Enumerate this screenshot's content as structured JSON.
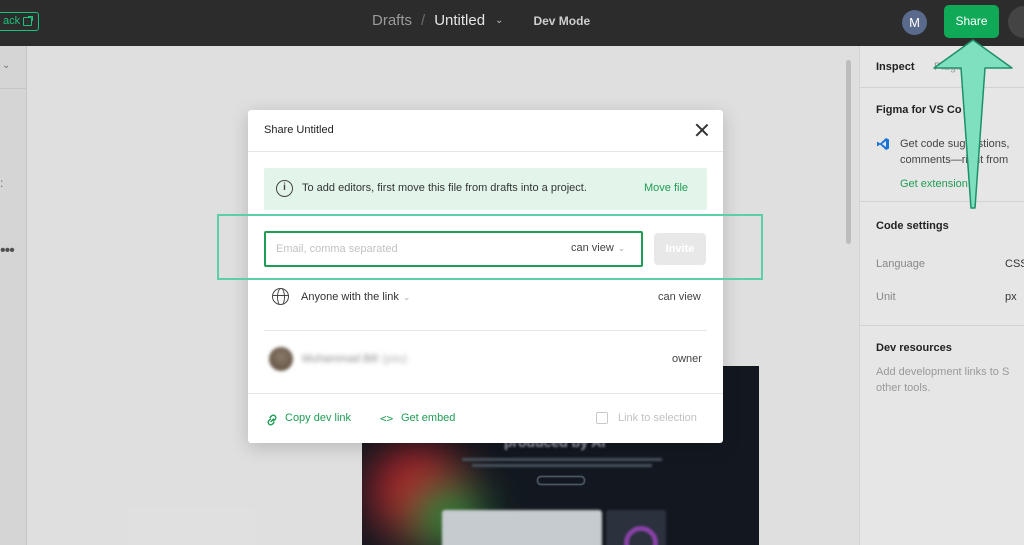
{
  "topbar": {
    "back_label": "ack",
    "breadcrumb_root": "Drafts",
    "breadcrumb_sep": "/",
    "file_name": "Untitled",
    "dev_mode_label": "Dev Mode",
    "avatar_initial": "M",
    "share_label": "Share"
  },
  "right_panel": {
    "tab_inspect": "Inspect",
    "tab_plugins": "Plugins",
    "vscode_title": "Figma for VS Co",
    "vscode_line1": "Get code suggestions,",
    "vscode_line2": "comments—right from",
    "vscode_link": "Get extension",
    "code_settings_title": "Code settings",
    "language_label": "Language",
    "language_value": "CSS",
    "unit_label": "Unit",
    "unit_value": "px",
    "dev_resources_title": "Dev resources",
    "dev_resources_line1": "Add development links to S",
    "dev_resources_line2": "other tools."
  },
  "preview": {
    "title": "produced by AI"
  },
  "modal": {
    "title": "Share Untitled",
    "notice_text": "To add editors, first move this file from drafts into a project.",
    "notice_action": "Move file",
    "email_value": "",
    "email_placeholder": "Email, comma separated",
    "email_permission": "can view",
    "invite_label": "Invite",
    "link_access_label": "Anyone with the link",
    "link_permission": "can view",
    "user_name": "Muhammad Bill",
    "user_suffix": "(you)",
    "user_role": "owner",
    "copy_dev_link": "Copy dev link",
    "get_embed": "Get embed",
    "link_to_selection": "Link to selection"
  },
  "colors": {
    "accent_green": "#0fa958",
    "link_green": "#1f9d55",
    "highlight": "#5ccfa8",
    "topbar_bg": "#2c2c2c"
  }
}
